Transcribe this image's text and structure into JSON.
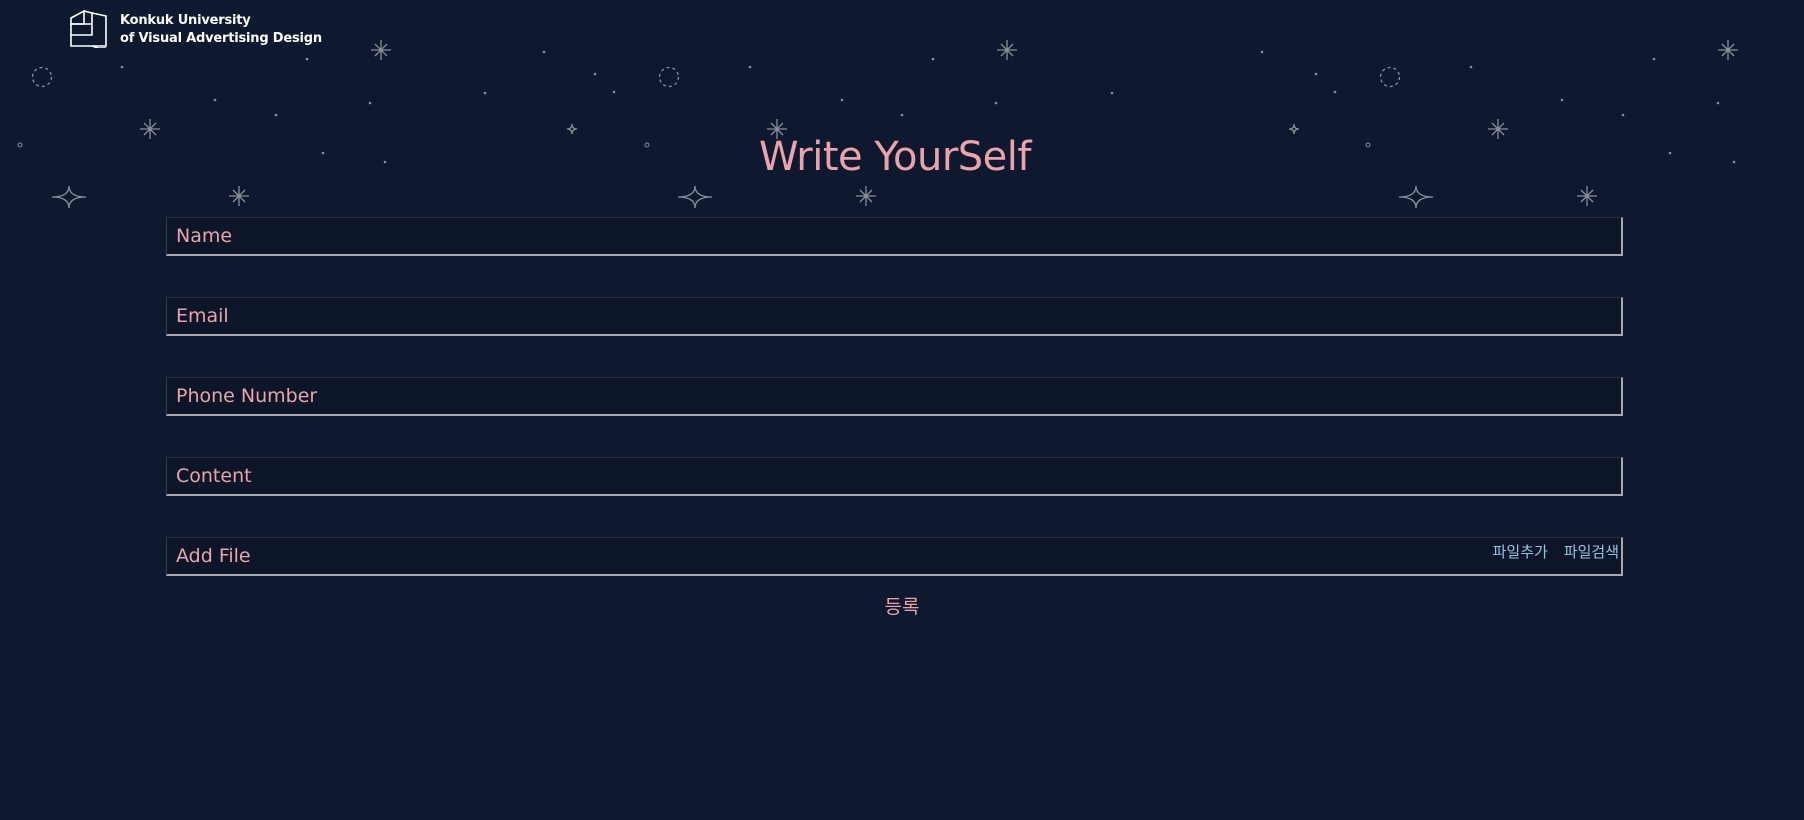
{
  "header": {
    "logo_icon": "building-logo-icon",
    "org_line1": "Konkuk University",
    "org_line2": "of Visual Advertising Design"
  },
  "title": "Write YourSelf",
  "form": {
    "name_placeholder": "Name",
    "email_placeholder": "Email",
    "phone_placeholder": "Phone Number",
    "content_placeholder": "Content",
    "file_placeholder": "Add File",
    "add_file_label": "파일추가",
    "search_file_label": "파일검색",
    "submit_label": "등록"
  },
  "colors": {
    "background": "#0e182e",
    "accent_pink": "#eaa3ab",
    "link_blue": "#8fc7e3",
    "star_gray": "#8a8f9c"
  }
}
